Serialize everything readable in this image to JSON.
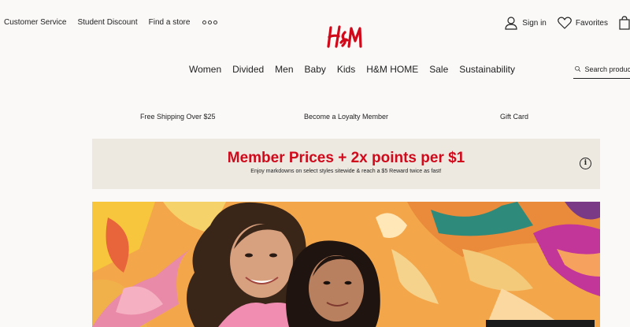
{
  "utility": {
    "customer_service": "Customer Service",
    "student_discount": "Student Discount",
    "find_store": "Find a store"
  },
  "account": {
    "sign_in": "Sign in",
    "favorites": "Favorites"
  },
  "nav": {
    "items": [
      "Women",
      "Divided",
      "Men",
      "Baby",
      "Kids",
      "H&M HOME",
      "Sale",
      "Sustainability"
    ]
  },
  "search": {
    "placeholder": "Search products"
  },
  "promos": {
    "shipping": "Free Shipping Over $25",
    "loyalty": "Become a Loyalty Member",
    "gift_card": "Gift Card"
  },
  "member_banner": {
    "headline": "Member Prices + 2x points per $1",
    "subtext": "Enjoy markdowns on select styles sitewide & reach a $5 Reward twice as fast!",
    "info_glyph": "i"
  },
  "colors": {
    "brand_red": "#d0091b",
    "banner_bg": "#ede9e1",
    "page_bg": "#faf9f8"
  }
}
